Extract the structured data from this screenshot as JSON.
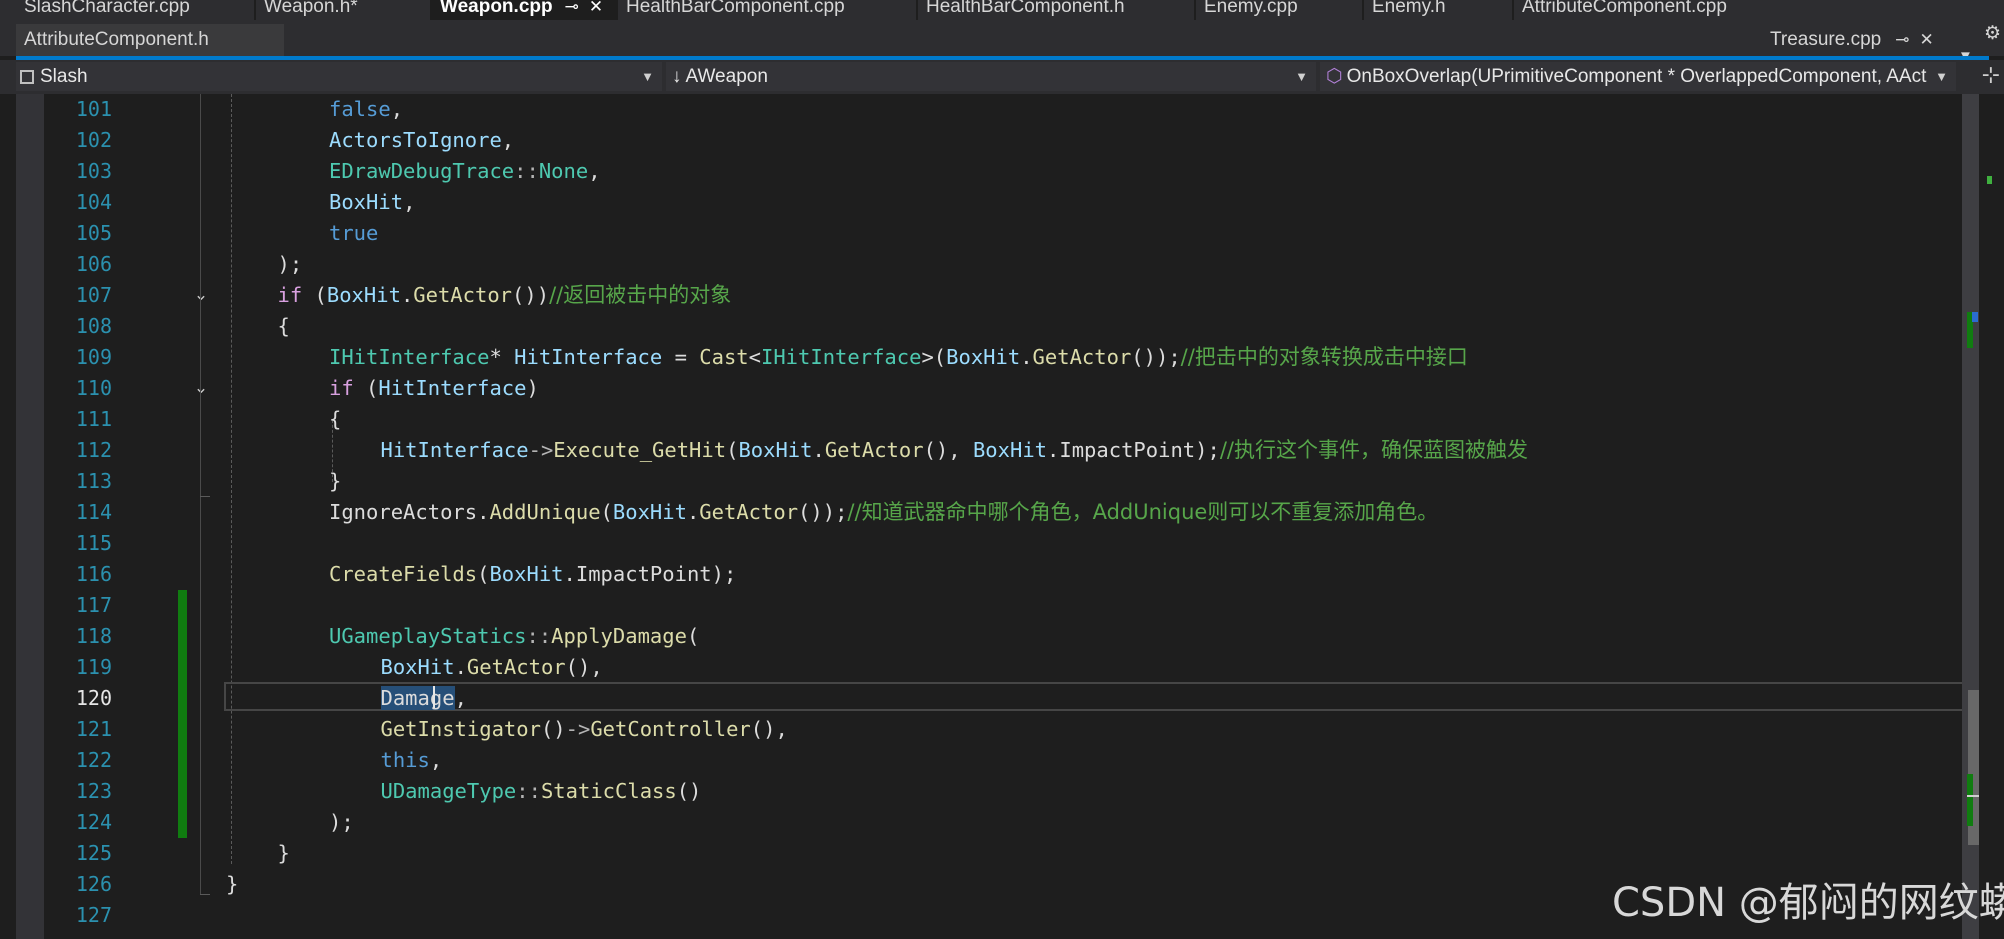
{
  "tabs_row1": [
    {
      "label": "SlashCharacter.cpp"
    },
    {
      "label": "Weapon.h*"
    },
    {
      "label": "Weapon.cpp",
      "active": true,
      "icons": [
        "pin-icon",
        "close-icon"
      ]
    },
    {
      "label": "HealthBarComponent.cpp"
    },
    {
      "label": "HealthBarComponent.h"
    },
    {
      "label": "Enemy.cpp"
    },
    {
      "label": "Enemy.h"
    },
    {
      "label": "AttributeComponent.cpp"
    }
  ],
  "tabs_row2": {
    "left": {
      "label": "AttributeComponent.h"
    },
    "right": {
      "label": "Treasure.cpp",
      "icons": [
        "pin-icon",
        "close-icon"
      ]
    },
    "overflow_icon": "chevron-down-icon"
  },
  "nav": {
    "project": "Slash",
    "class_scope": "AWeapon",
    "member": "OnBoxOverlap(UPrimitiveComponent * OverlappedComponent, AAct"
  },
  "editor": {
    "current_line": "120",
    "line_numbers": [
      "101",
      "102",
      "103",
      "104",
      "105",
      "106",
      "107",
      "108",
      "109",
      "110",
      "111",
      "112",
      "113",
      "114",
      "115",
      "116",
      "117",
      "118",
      "119",
      "120",
      "121",
      "122",
      "123",
      "124",
      "125",
      "126",
      "127"
    ],
    "lines": [
      [
        [
          "kw",
          "false"
        ],
        [
          "",
          ","
        ]
      ],
      [
        [
          "vr",
          "ActorsToIgnore"
        ],
        [
          "",
          ","
        ]
      ],
      [
        [
          "ty",
          "EDrawDebugTrace"
        ],
        [
          "pun",
          "::"
        ],
        [
          "ty",
          "None"
        ],
        [
          "",
          ","
        ]
      ],
      [
        [
          "vr",
          "BoxHit"
        ],
        [
          "",
          ","
        ]
      ],
      [
        [
          "kw",
          "true"
        ]
      ],
      [
        [
          "",
          ");"
        ]
      ],
      [
        [
          "ctl",
          "if"
        ],
        [
          "",
          " ("
        ],
        [
          "vr",
          "BoxHit"
        ],
        [
          "",
          "."
        ],
        [
          "fn",
          "GetActor"
        ],
        [
          "",
          "())"
        ],
        [
          "cm",
          "//返回被击中的对象"
        ]
      ],
      [
        [
          "",
          "{"
        ]
      ],
      [
        [
          "ty",
          "IHitInterface"
        ],
        [
          "",
          "* "
        ],
        [
          "vr",
          "HitInterface"
        ],
        [
          "",
          " = "
        ],
        [
          "fn",
          "Cast"
        ],
        [
          "",
          "<"
        ],
        [
          "ty",
          "IHitInterface"
        ],
        [
          "",
          ">("
        ],
        [
          "vr",
          "BoxHit"
        ],
        [
          "",
          "."
        ],
        [
          "fn",
          "GetActor"
        ],
        [
          "",
          "());"
        ],
        [
          "cm",
          "//把击中的对象转换成击中接口"
        ]
      ],
      [
        [
          "ctl",
          "if"
        ],
        [
          "",
          " ("
        ],
        [
          "vr",
          "HitInterface"
        ],
        [
          "",
          ")"
        ]
      ],
      [
        [
          "",
          "{"
        ]
      ],
      [
        [
          "vr",
          "HitInterface"
        ],
        [
          "pun",
          "->"
        ],
        [
          "fn",
          "Execute_GetHit"
        ],
        [
          "",
          "("
        ],
        [
          "vr",
          "BoxHit"
        ],
        [
          "",
          "."
        ],
        [
          "fn",
          "GetActor"
        ],
        [
          "",
          "(), "
        ],
        [
          "vr",
          "BoxHit"
        ],
        [
          "",
          "."
        ],
        [
          "",
          "ImpactPoint"
        ],
        [
          "",
          ");"
        ],
        [
          "cm",
          "//执行这个事件，确保蓝图被触发"
        ]
      ],
      [
        [
          "",
          "}"
        ]
      ],
      [
        [
          "",
          "IgnoreActors"
        ],
        [
          "",
          "."
        ],
        [
          "fn",
          "AddUnique"
        ],
        [
          "",
          "("
        ],
        [
          "vr",
          "BoxHit"
        ],
        [
          "",
          "."
        ],
        [
          "fn",
          "GetActor"
        ],
        [
          "",
          "());"
        ],
        [
          "cm",
          "//知道武器命中哪个角色，AddUnique则可以不重复添加角色。"
        ]
      ],
      [],
      [
        [
          "fn",
          "CreateFields"
        ],
        [
          "",
          "("
        ],
        [
          "vr",
          "BoxHit"
        ],
        [
          "",
          "."
        ],
        [
          "",
          "ImpactPoint"
        ],
        [
          "",
          ");"
        ]
      ],
      [],
      [
        [
          "ty",
          "UGameplayStatics"
        ],
        [
          "pun",
          "::"
        ],
        [
          "fn",
          "ApplyDamage"
        ],
        [
          "",
          "("
        ]
      ],
      [
        [
          "vr",
          "BoxHit"
        ],
        [
          "",
          "."
        ],
        [
          "fn",
          "GetActor"
        ],
        [
          "",
          "(),"
        ]
      ],
      [
        [
          "sel",
          "Damage"
        ],
        [
          "",
          ","
        ]
      ],
      [
        [
          "fn",
          "GetInstigator"
        ],
        [
          "",
          "()"
        ],
        [
          "pun",
          "->"
        ],
        [
          "fn",
          "GetController"
        ],
        [
          "",
          "(),"
        ]
      ],
      [
        [
          "kw",
          "this"
        ],
        [
          "",
          ","
        ]
      ],
      [
        [
          "ty",
          "UDamageType"
        ],
        [
          "pun",
          "::"
        ],
        [
          "fn",
          "StaticClass"
        ],
        [
          "",
          "()"
        ]
      ],
      [
        [
          "",
          ");"
        ]
      ],
      [
        [
          "",
          "}"
        ]
      ],
      [
        [
          "",
          "}"
        ]
      ],
      []
    ],
    "indent_levels": [
      6,
      6,
      6,
      6,
      6,
      5,
      5,
      5,
      6,
      6,
      6,
      7,
      6,
      6,
      6,
      6,
      6,
      6,
      7,
      7,
      7,
      7,
      7,
      6,
      5,
      4,
      4
    ]
  },
  "colors": {
    "background": "#1e1e1e",
    "accent": "#007acc",
    "changed_margin": "#107c10"
  },
  "watermark": "CSDN @郁闷的网纹蟒"
}
